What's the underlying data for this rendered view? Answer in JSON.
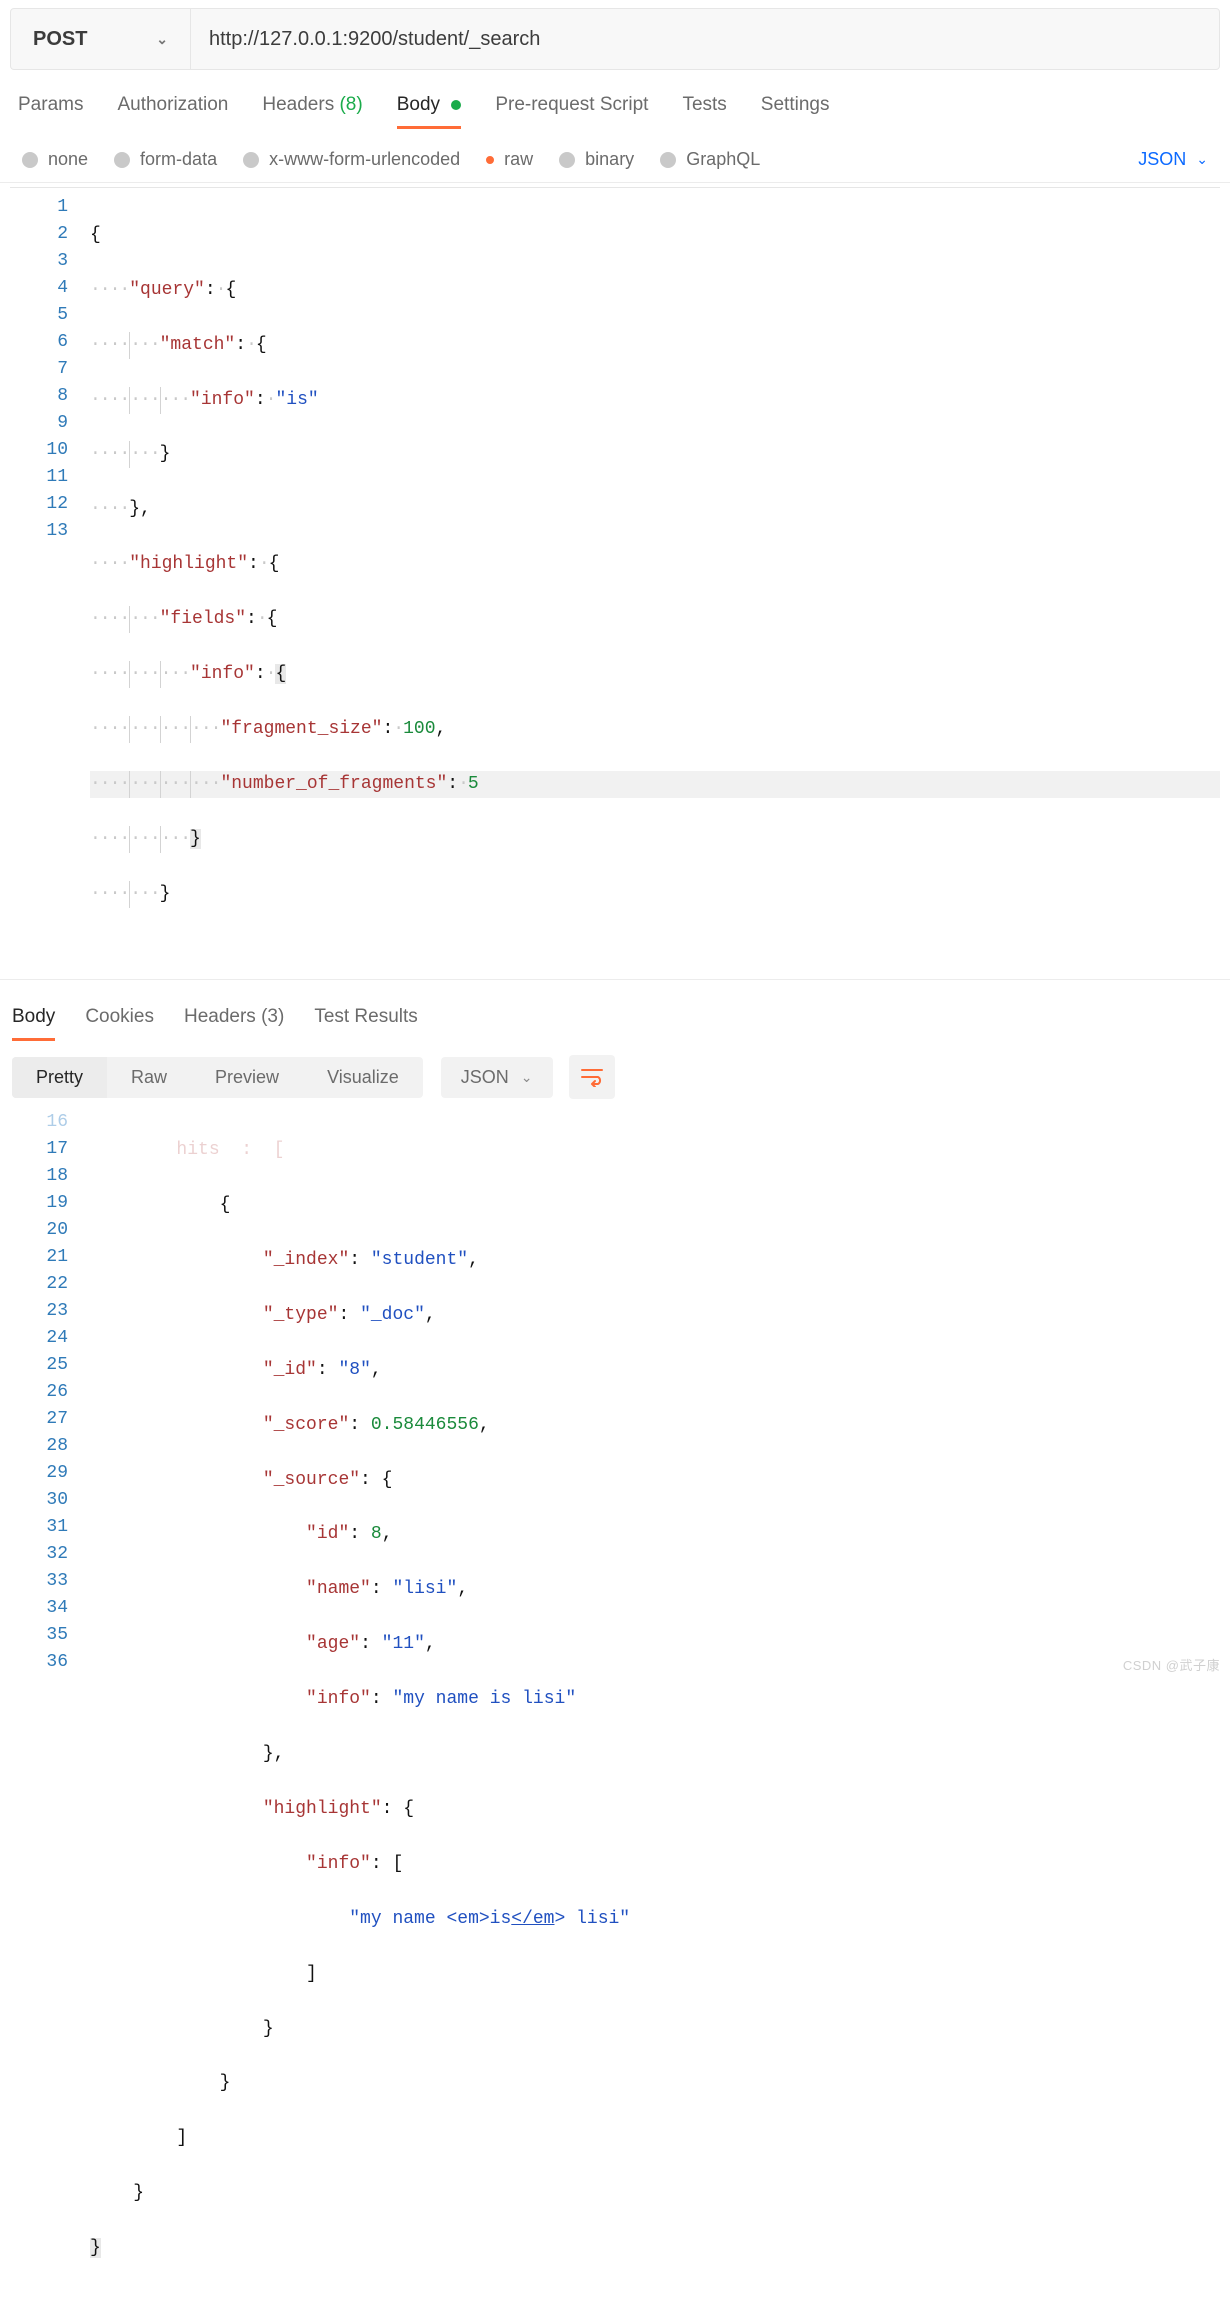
{
  "request": {
    "method": "POST",
    "url": "http://127.0.0.1:9200/student/_search"
  },
  "request_tabs": {
    "params": "Params",
    "authorization": "Authorization",
    "headers_label": "Headers",
    "headers_count": "(8)",
    "body": "Body",
    "pre_request": "Pre-request Script",
    "tests": "Tests",
    "settings": "Settings"
  },
  "body_types": {
    "none": "none",
    "form_data": "form-data",
    "xwww": "x-www-form-urlencoded",
    "raw": "raw",
    "binary": "binary",
    "graphql": "GraphQL",
    "lang": "JSON"
  },
  "request_body_editor": {
    "lines": [
      "1",
      "2",
      "3",
      "4",
      "5",
      "6",
      "7",
      "8",
      "9",
      "10",
      "11",
      "12",
      "13"
    ],
    "content": {
      "query": {
        "match": {
          "info": "is"
        }
      },
      "highlight": {
        "fields": {
          "info": {
            "fragment_size": 100,
            "number_of_fragments": 5
          }
        }
      }
    }
  },
  "response_tabs": {
    "body": "Body",
    "cookies": "Cookies",
    "headers_label": "Headers",
    "headers_count": "(3)",
    "test_results": "Test Results"
  },
  "response_toolbar": {
    "pretty": "Pretty",
    "raw": "Raw",
    "preview": "Preview",
    "visualize": "Visualize",
    "lang": "JSON"
  },
  "response_body": {
    "visible_line_numbers": [
      "16",
      "17",
      "18",
      "19",
      "20",
      "21",
      "22",
      "23",
      "24",
      "25",
      "26",
      "27",
      "28",
      "29",
      "30",
      "31",
      "32",
      "33",
      "34",
      "35",
      "36"
    ],
    "partial_top_text": "hits  :  [",
    "hit": {
      "_index": "student",
      "_type": "_doc",
      "_id": "8",
      "_score": 0.58446556,
      "_source": {
        "id": 8,
        "name": "lisi",
        "age": "11",
        "info": "my name is lisi"
      },
      "highlight": {
        "info": [
          "my name <em>is</em> lisi"
        ]
      }
    }
  },
  "watermark": "CSDN @武子康"
}
